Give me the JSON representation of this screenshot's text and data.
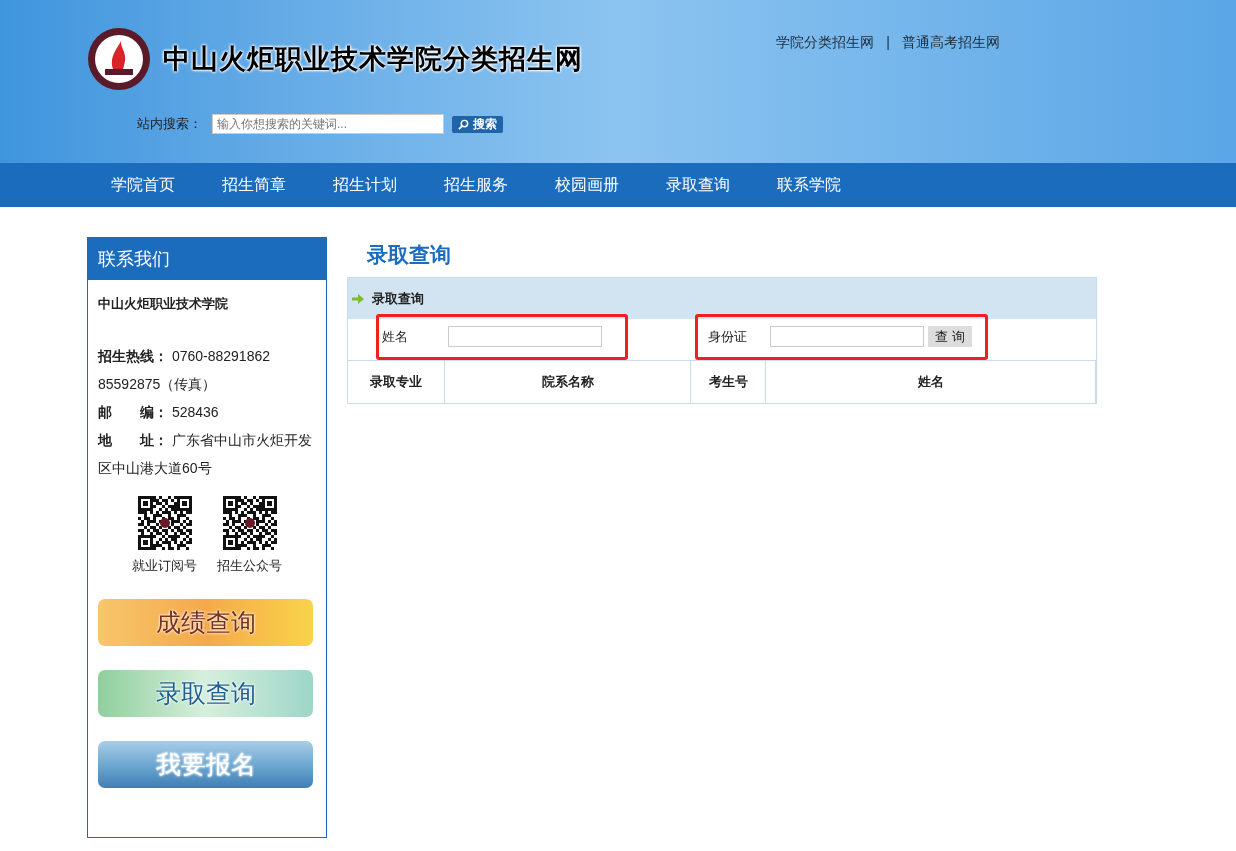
{
  "header": {
    "site_title": "中山火炬职业技术学院分类招生网",
    "top_links": [
      "学院分类招生网",
      "普通高考招生网"
    ],
    "top_link_separator": "|",
    "search": {
      "label": "站内搜索：",
      "placeholder": "输入你想搜索的关键词...",
      "button": "搜索"
    }
  },
  "nav": {
    "items": [
      "学院首页",
      "招生简章",
      "招生计划",
      "招生服务",
      "校园画册",
      "录取查询",
      "联系学院"
    ]
  },
  "sidebar": {
    "title": "联系我们",
    "school": "中山火炬职业技术学院",
    "contact_lines": [
      "**招生热线：** 0760-88291862",
      "85592875（传真）",
      "**邮　　编：** 528436",
      "**地　　址：** 广东省中山市火炬开发区中山港大道60号"
    ],
    "qr_codes": [
      {
        "caption": "就业订阅号"
      },
      {
        "caption": "招生公众号"
      }
    ],
    "banners": [
      {
        "kind": "orange",
        "label": "成绩查询"
      },
      {
        "kind": "green",
        "label": "录取查询"
      },
      {
        "kind": "blue",
        "label": "我要报名"
      }
    ]
  },
  "main": {
    "title": "录取查询",
    "panel_title": "录取查询",
    "fields": [
      {
        "label": "姓名",
        "highlighted": true
      },
      {
        "label": "身份证",
        "highlighted": true
      }
    ],
    "query_button": "查 询",
    "table": {
      "columns": [
        "录取专业",
        "院系名称",
        "考生号",
        "姓名"
      ]
    }
  }
}
